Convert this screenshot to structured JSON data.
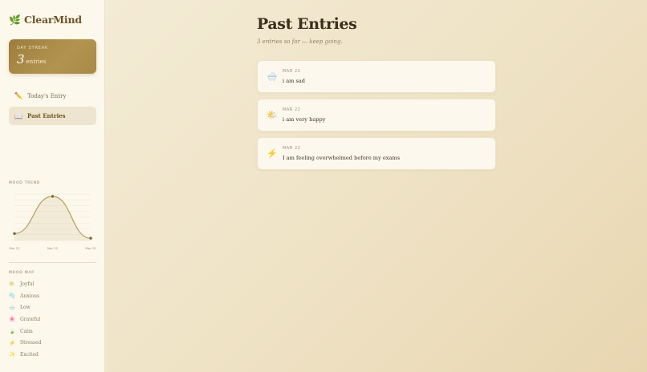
{
  "app": {
    "name": "ClearMind",
    "logo_icon": "🌿"
  },
  "streak": {
    "label": "DAY STREAK",
    "value": "3",
    "unit": "entries"
  },
  "nav": [
    {
      "label": "Today's Entry",
      "icon": "✏️",
      "active": false
    },
    {
      "label": "Past Entries",
      "icon": "📖",
      "active": true
    }
  ],
  "mood_trend": {
    "label": "MOOD TREND",
    "chart_data": {
      "type": "line",
      "x": [
        "Mar 22",
        "Mar 22",
        "Mar 22"
      ],
      "values": [
        0.15,
        0.95,
        0.05
      ],
      "ylim": [
        0,
        1
      ],
      "grid": true,
      "color": "#b39656"
    }
  },
  "mood_map": {
    "label": "MOOD MAP",
    "items": [
      {
        "label": "Joyful",
        "icon": "🌤️"
      },
      {
        "label": "Anxious",
        "icon": "🫧"
      },
      {
        "label": "Low",
        "icon": "🌨️"
      },
      {
        "label": "Grateful",
        "icon": "🌸"
      },
      {
        "label": "Calm",
        "icon": "🍃"
      },
      {
        "label": "Stressed",
        "icon": "⚡"
      },
      {
        "label": "Excited",
        "icon": "✨"
      }
    ]
  },
  "main": {
    "title": "Past Entries",
    "subtitle": "3 entries so far — keep going.",
    "entries": [
      {
        "date": "MAR 22",
        "text": "i am sad",
        "icon": "🌨️"
      },
      {
        "date": "MAR 22",
        "text": "i am very happy",
        "icon": "🌤️"
      },
      {
        "date": "MAR 22",
        "text": "I am feeling overwhelmed before my exams",
        "icon": "⚡"
      }
    ]
  }
}
